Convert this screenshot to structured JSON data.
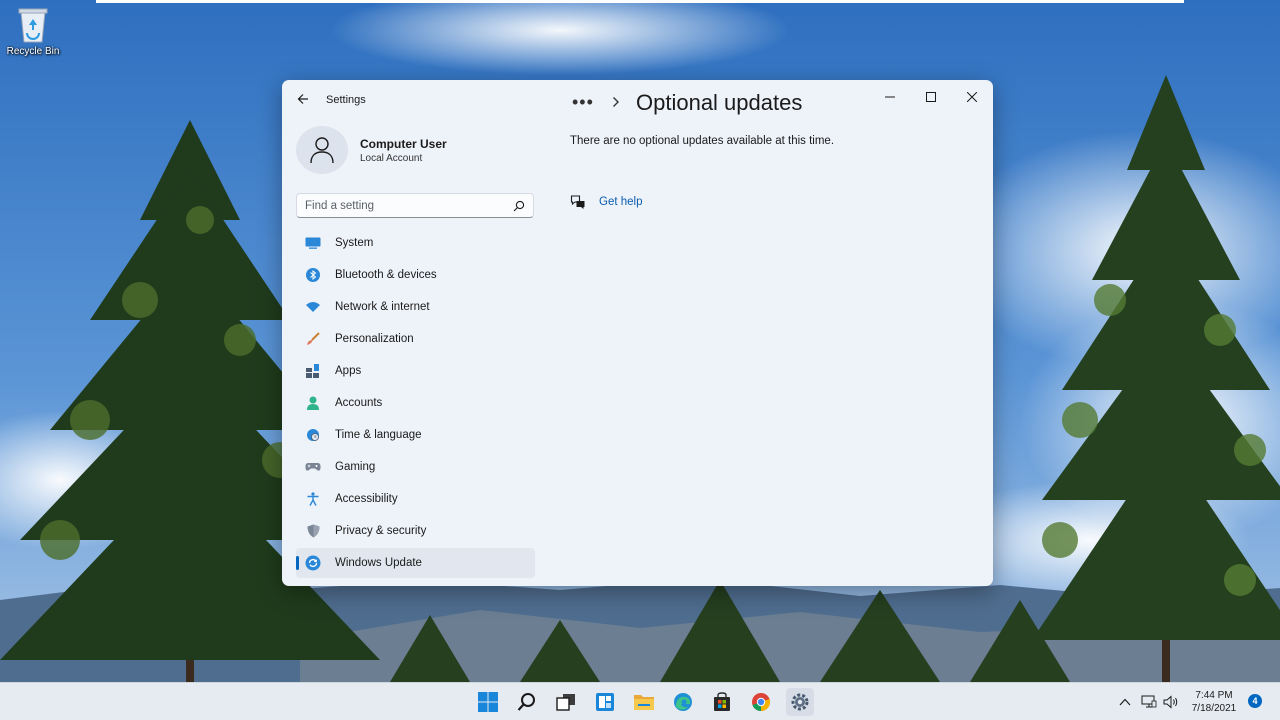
{
  "desktop": {
    "recycle_bin_label": "Recycle Bin"
  },
  "window": {
    "app_title": "Settings",
    "user": {
      "name": "Computer User",
      "account_type": "Local Account"
    },
    "search": {
      "placeholder": "Find a setting"
    },
    "nav_items": [
      {
        "label": "System",
        "icon": "system-icon"
      },
      {
        "label": "Bluetooth & devices",
        "icon": "bluetooth-icon"
      },
      {
        "label": "Network & internet",
        "icon": "wifi-icon"
      },
      {
        "label": "Personalization",
        "icon": "brush-icon"
      },
      {
        "label": "Apps",
        "icon": "apps-icon"
      },
      {
        "label": "Accounts",
        "icon": "person-icon"
      },
      {
        "label": "Time & language",
        "icon": "globe-clock-icon"
      },
      {
        "label": "Gaming",
        "icon": "gamepad-icon"
      },
      {
        "label": "Accessibility",
        "icon": "accessibility-icon"
      },
      {
        "label": "Privacy & security",
        "icon": "shield-icon"
      },
      {
        "label": "Windows Update",
        "icon": "windows-update-icon",
        "active": true
      }
    ],
    "breadcrumb": {
      "overflow": "•••",
      "current": "Optional updates"
    },
    "content": {
      "message": "There are no optional updates available at this time.",
      "help_link": "Get help"
    }
  },
  "taskbar": {
    "apps": [
      "start-icon",
      "search-icon",
      "task-view-icon",
      "widgets-icon",
      "file-explorer-icon",
      "edge-icon",
      "store-icon",
      "chrome-icon",
      "settings-icon"
    ],
    "clock": {
      "time": "7:44 PM",
      "date": "7/18/2021"
    },
    "notification_count": "4"
  },
  "colors": {
    "accent": "#0067c0",
    "window_bg": "#eef2f9",
    "taskbar_bg": "#e6ebf1",
    "link": "#0b5cad"
  }
}
